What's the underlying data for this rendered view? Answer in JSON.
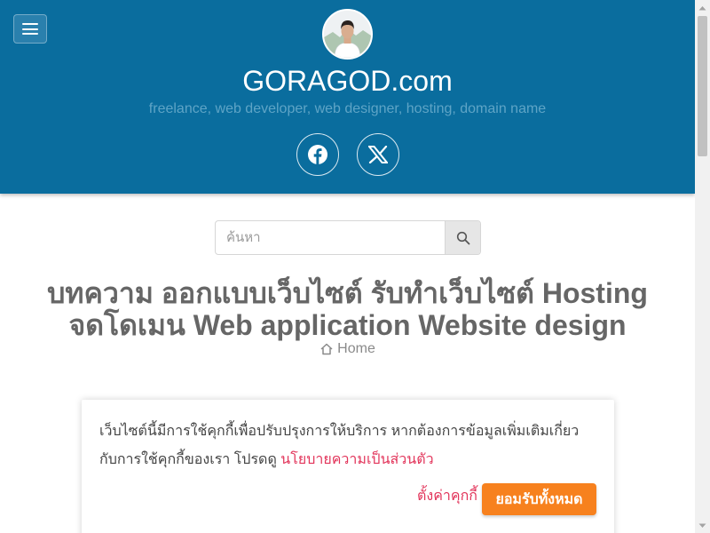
{
  "header": {
    "menu_icon": "hamburger-icon",
    "site_title": "GORAGOD.com",
    "tagline": "freelance, web developer, web designer, hosting, domain name",
    "social": [
      {
        "name": "facebook",
        "icon": "facebook-icon"
      },
      {
        "name": "x",
        "icon": "x-icon"
      }
    ],
    "colors": {
      "background": "#0a6d9e",
      "tagline": "#5ea4c6"
    }
  },
  "search": {
    "placeholder": "ค้นหา",
    "value": "",
    "icon": "search-icon"
  },
  "main": {
    "headline": "บทความ ออกแบบเว็บไซต์ รับทำเว็บไซต์ Hosting จดโดเมน Web application Website design",
    "breadcrumb": {
      "icon": "home-icon",
      "label": "Home"
    }
  },
  "cookie_notice": {
    "message": "เว็บไซต์นี้มีการใช้คุกกี้เพื่อปรับปรุงการให้บริการ หากต้องการข้อมูลเพิ่มเติมเกี่ยวกับการใช้คุกกี้ของเรา โปรดดู",
    "policy_link": "นโยบายความเป็นส่วนตัว",
    "settings_label": "ตั้งค่าคุกกี้",
    "accept_label": "ยอมรับทั้งหมด",
    "colors": {
      "link": "#e2345a",
      "accept": "#f7811e"
    }
  }
}
